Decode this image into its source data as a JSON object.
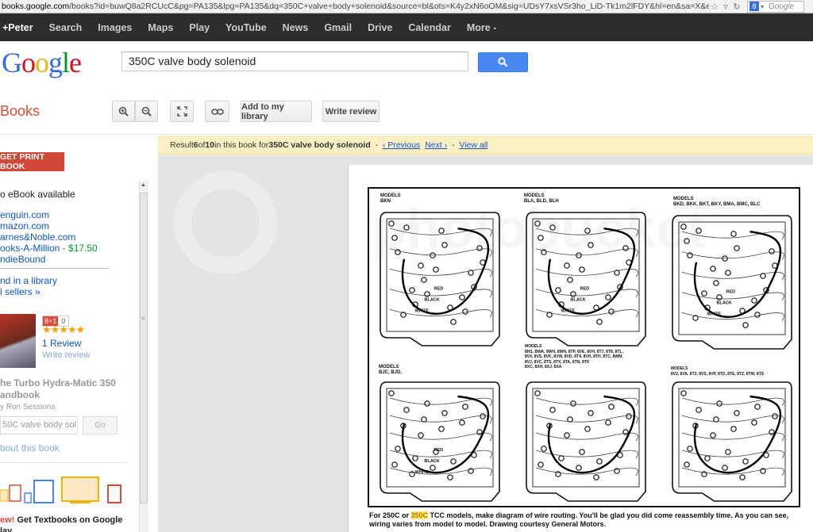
{
  "browser": {
    "url_host": "books.google.com",
    "url_rest": "/books?id=buwQ8a2RCUcC&pg=PA135&lpg=PA135&dq=350C+valve+body+solenoid&source=bl&ots=K4y2xN6oOM&sig=UDsY7xsVSr3ho_LiD-Tk1m2lFDY&hl=en&sa=X&ei=7iwdU5X7OoSGkC",
    "search_engine_placeholder": "Google"
  },
  "topnav": {
    "items": [
      "+Peter",
      "Search",
      "Images",
      "Maps",
      "Play",
      "YouTube",
      "News",
      "Gmail",
      "Drive",
      "Calendar",
      "More -"
    ]
  },
  "header": {
    "logo": "Google",
    "search_value": "350C valve body solenoid"
  },
  "toolbar": {
    "section": "Books",
    "add_library": "Add to my library",
    "write_review": "Write review"
  },
  "sidebar": {
    "print_button": "GET PRINT BOOK",
    "ebook": "o eBook available",
    "sellers": [
      "enguin.com",
      "mazon.com",
      "arnes&Noble.com",
      "ooks-A-Million"
    ],
    "million_price": " - $17.50",
    "indiebound": "ndieBound",
    "library": "nd in a library",
    "all_sellers": "l sellers »",
    "gplus_count": "0",
    "rating_stars": "★★★★★",
    "reviews": "1 Review",
    "write_review": "Write review",
    "book_title_1": "he Turbo Hydra-Matic 350",
    "book_title_2": "andbook",
    "author": "y Ron Sessions",
    "search_in_book": "50C valve body sol",
    "go_button": "Go",
    "about": "bout this book",
    "promo_prefix": "ew!",
    "promo_text": " Get Textbooks on Google",
    "promo_text_2": "lay"
  },
  "resultbar": {
    "prefix": "Result ",
    "result_num": "6",
    "of": " of ",
    "total": "10",
    "mid": " in this book for ",
    "query": "350C valve body solenoid",
    "sep": "  -  ",
    "prev": "‹ Previous",
    "next": "Next ›",
    "sep2": "  -  ",
    "view_all": "View all"
  },
  "page": {
    "watermark": "photobucket",
    "models": {
      "p1": "MODELS\nBKN",
      "p2": "MODELS\nBLA, BLD, BLH",
      "p3": "MODELS\nBKD, BKK, BKT, BKY, BMA, BMC, BLC",
      "p4": "MODELS\nBJC, BJD,",
      "p5": "MODELS\n8HS, BWA, 8WH, 8WN, 8TP, 8VE, 8VH, 8T7, 8T8, 8TL,\n8V4, 8VS, 8VK, 8VW, 8VD, 8T4, 8VH, 8TH, 8TC, 8WM,\n8VJ, 8VC, 8TS, 8TX, 8TA, 8TN, 8TK\n8XC, 8XH, 8XJ, 8XA",
      "p6": "MODELS\n8V2, 8VA, 8T3, 8VS, 8VP, 8TD, 8TE, 8TZ, 8TW, 8TS"
    },
    "wire_labels": [
      "RED",
      "BLACK",
      "WHITE"
    ],
    "caption_pre": "For 250C or ",
    "caption_highlight": "350C",
    "caption_post": " TCC models, make diagram of wire routing. You'll be glad you did come reassembly time. As you can see, wiring varies from model to model. Drawing courtesy General Motors."
  },
  "colors": {
    "nav_bg": "#2d2d2d",
    "print_btn": "#d14836",
    "search_btn": "#4889f1",
    "result_bar": "#fbf0c3",
    "link": "#1155cc"
  }
}
